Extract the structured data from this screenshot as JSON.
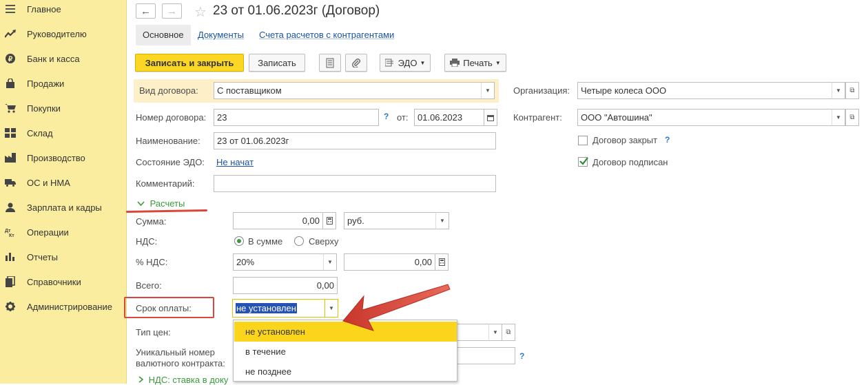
{
  "sidebar": {
    "items": [
      {
        "label": "Главное",
        "icon": "menu-icon"
      },
      {
        "label": "Руководителю",
        "icon": "trend-icon"
      },
      {
        "label": "Банк и касса",
        "icon": "ruble-icon"
      },
      {
        "label": "Продажи",
        "icon": "bag-icon"
      },
      {
        "label": "Покупки",
        "icon": "cart-icon"
      },
      {
        "label": "Склад",
        "icon": "warehouse-icon"
      },
      {
        "label": "Производство",
        "icon": "factory-icon"
      },
      {
        "label": "ОС и НМА",
        "icon": "truck-icon"
      },
      {
        "label": "Зарплата и кадры",
        "icon": "person-icon"
      },
      {
        "label": "Операции",
        "icon": "dt-kt-icon"
      },
      {
        "label": "Отчеты",
        "icon": "bar-chart-icon"
      },
      {
        "label": "Справочники",
        "icon": "books-icon"
      },
      {
        "label": "Администрирование",
        "icon": "gear-icon"
      }
    ]
  },
  "header": {
    "title": "23 от 01.06.2023г (Договор)",
    "back": "←",
    "forward": "→",
    "star": "☆"
  },
  "tabs": {
    "main": "Основное",
    "documents": "Документы",
    "accounts": "Счета расчетов с контрагентами"
  },
  "toolbar": {
    "save_close": "Записать и закрыть",
    "save": "Записать",
    "edo": "ЭДО",
    "print": "Печать"
  },
  "form": {
    "contract_type_label": "Вид договора:",
    "contract_type_value": "С поставщиком",
    "number_label": "Номер договора:",
    "number_value": "23",
    "help": "?",
    "date_label": "от:",
    "date_value": "01.06.2023",
    "name_label": "Наименование:",
    "name_value": "23 от 01.06.2023г",
    "edo_state_label": "Состояние ЭДО:",
    "edo_state_value": "Не начат",
    "comment_label": "Комментарий:",
    "comment_value": "",
    "org_label": "Организация:",
    "org_value": "Четыре колеса ООО",
    "contractor_label": "Контрагент:",
    "contractor_value": "ООО \"Автошина\"",
    "closed_label": "Договор закрыт",
    "closed_checked": false,
    "signed_label": "Договор подписан",
    "signed_checked": true
  },
  "settlements": {
    "section_label": "Расчеты",
    "sum_label": "Сумма:",
    "sum_value": "0,00",
    "currency_value": "руб.",
    "vat_label": "НДС:",
    "vat_in_sum": "В сумме",
    "vat_on_top": "Сверху",
    "vat_rate_label": "% НДС:",
    "vat_rate_value": "20%",
    "vat_amount_value": "0,00",
    "total_label": "Всего:",
    "total_value": "0,00",
    "payment_term_label": "Срок оплаты:",
    "payment_term_value": "не установлен",
    "price_type_label": "Тип цен:",
    "unique_number_label_line1": "Уникальный номер",
    "unique_number_label_line2": "валютного контракта:",
    "vat_rate_section": "НДС: ставка в доку"
  },
  "dropdown": {
    "options": [
      "не установлен",
      "в течение",
      "не позднее"
    ],
    "selected_index": 0
  },
  "colors": {
    "sidebar_bg": "#fbeda0",
    "primary_button": "#fbd624",
    "highlight_row": "#fdf0c8",
    "annotation_red": "#d9473a",
    "selection_blue": "#2553b5"
  }
}
